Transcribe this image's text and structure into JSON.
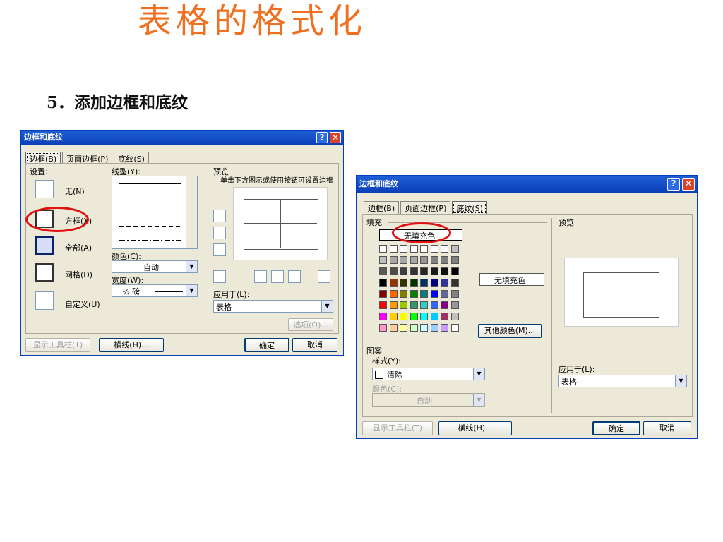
{
  "slide": {
    "title": "表格的格式化",
    "subtitle": "5．添加边框和底纹"
  },
  "dialog1": {
    "title": "边框和底纹",
    "tabs": [
      "边框(B)",
      "页面边框(P)",
      "底纹(S)"
    ],
    "settings_label": "设置:",
    "settings": [
      "无(N)",
      "方框(X)",
      "全部(A)",
      "网格(D)",
      "自定义(U)"
    ],
    "line_style_label": "线型(Y):",
    "color_label": "颜色(C):",
    "color_value": "自动",
    "width_label": "宽度(W):",
    "width_value": "½ 磅",
    "preview_label": "预览",
    "preview_hint": "单击下方图示或使用按钮可设置边框",
    "apply_to_label": "应用于(L):",
    "apply_to_value": "表格",
    "options_button": "选项(O)...",
    "toolbar_button": "显示工具栏(T)",
    "hline_button": "横线(H)...",
    "ok_button": "确定",
    "cancel_button": "取消"
  },
  "dialog2": {
    "title": "边框和底纹",
    "tabs": [
      "边框(B)",
      "页面边框(P)",
      "底纹(S)"
    ],
    "fill_label": "填充",
    "no_fill": "无填充色",
    "no_fill_display": "无填充色",
    "more_colors_button": "其他颜色(M)...",
    "palette": [
      [
        "#ffffff",
        "#ffffff",
        "#ffffff",
        "#ffffff",
        "#ffffff",
        "#ffffff",
        "#ffffff",
        "#c0c0c0"
      ],
      [
        "#bfbfbf",
        "#a6a6a6",
        "#a6a6a6",
        "#a6a6a6",
        "#969696",
        "#808080",
        "#808080",
        "#808080"
      ],
      [
        "#595959",
        "#4d4d4d",
        "#404040",
        "#333333",
        "#262626",
        "#1a1a1a",
        "#111111",
        "#000000"
      ],
      [
        "#000000",
        "#993300",
        "#333300",
        "#003300",
        "#003366",
        "#000080",
        "#333399",
        "#333333"
      ],
      [
        "#800000",
        "#ff6600",
        "#808000",
        "#008000",
        "#008080",
        "#0000ff",
        "#666699",
        "#808080"
      ],
      [
        "#ff0000",
        "#ff9900",
        "#99cc00",
        "#339966",
        "#33cccc",
        "#3366ff",
        "#800080",
        "#969696"
      ],
      [
        "#ff00ff",
        "#ffcc00",
        "#ffff00",
        "#00ff00",
        "#00ffff",
        "#00ccff",
        "#993366",
        "#c0c0c0"
      ],
      [
        "#ff99cc",
        "#ffcc99",
        "#ffff99",
        "#ccffcc",
        "#ccffff",
        "#99ccff",
        "#cc99ff",
        "#ffffff"
      ]
    ],
    "pattern_label": "图案",
    "style_label": "样式(Y):",
    "style_value": "清除",
    "pattern_color_label": "颜色(C):",
    "pattern_color_value": "自动",
    "preview_label": "预览",
    "apply_to_label": "应用于(L):",
    "apply_to_value": "表格",
    "toolbar_button": "显示工具栏(T)",
    "hline_button": "横线(H)...",
    "ok_button": "确定",
    "cancel_button": "取消"
  }
}
